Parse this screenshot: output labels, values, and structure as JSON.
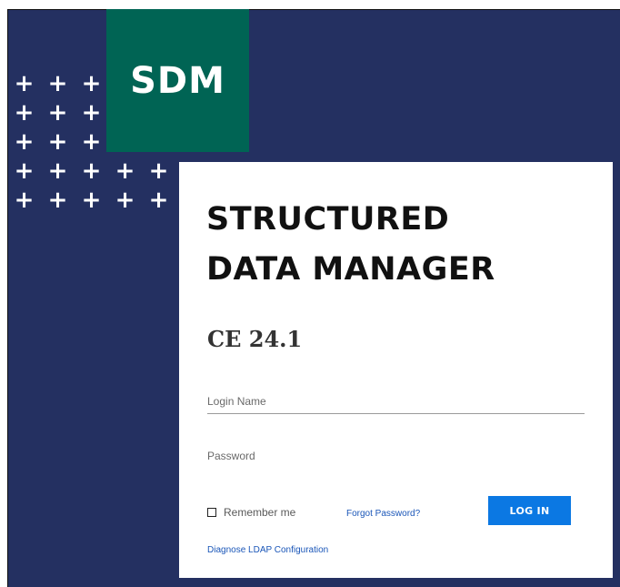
{
  "logo": {
    "text": "SDM"
  },
  "decor": {
    "plus_rows": [
      3,
      3,
      3,
      5,
      5
    ],
    "plus_glyph": "+"
  },
  "title": {
    "line1": "STRUCTURED",
    "line2": "DATA MANAGER"
  },
  "version": "CE 24.1",
  "form": {
    "login_placeholder": "Login Name",
    "password_placeholder": "Password",
    "remember_label": "Remember me",
    "remember_checked": false,
    "forgot_link": "Forgot Password?",
    "login_button": "LOG IN",
    "diagnose_link": "Diagnose LDAP Configuration"
  },
  "colors": {
    "background": "#243061",
    "logo_box": "#006454",
    "button": "#0b78e3",
    "link": "#1a56b8"
  }
}
